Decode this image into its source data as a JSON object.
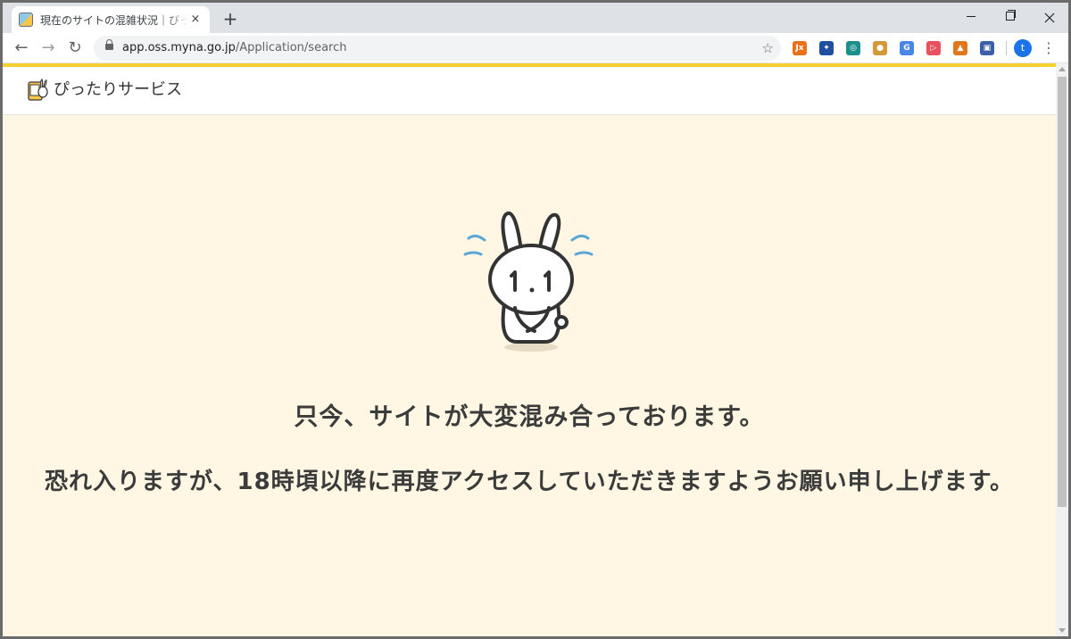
{
  "browser": {
    "tab_title": "現在のサイトの混雑状況｜ぴったりサービス",
    "tab_close_glyph": "×",
    "new_tab_glyph": "+",
    "url_host": "app.oss.myna.go.jp",
    "url_path": "/Application/search",
    "star_glyph": "☆",
    "back_glyph": "←",
    "forward_glyph": "→",
    "reload_glyph": "↻",
    "profile_initial": "t",
    "menu_glyph": "⋮",
    "extensions": [
      {
        "name": "jx-extension-icon",
        "label": "Jx",
        "color": "#e8711a"
      },
      {
        "name": "rocket-extension-icon",
        "label": "✦",
        "color": "#1e4fa0"
      },
      {
        "name": "circle-extension-icon",
        "label": "◎",
        "color": "#1b8f8a"
      },
      {
        "name": "cookie-extension-icon",
        "label": "●",
        "color": "#d49a3a"
      },
      {
        "name": "translate-extension-icon",
        "label": "G",
        "color": "#4a86e8"
      },
      {
        "name": "arrow-extension-icon",
        "label": "▷",
        "color": "#e8505b"
      },
      {
        "name": "fox-extension-icon",
        "label": "▲",
        "color": "#e2761b"
      },
      {
        "name": "note-extension-icon",
        "label": "▣",
        "color": "#3b5fa8"
      }
    ]
  },
  "site": {
    "brand": "ぴったりサービス",
    "accent_color": "#f5d12f",
    "background_color": "#fff7e4"
  },
  "message": {
    "line1": "只今、サイトが大変混み合っております。",
    "line2": "恐れ入りますが、18時頃以降に再度アクセスしていただきますようお願い申し上げます。"
  }
}
